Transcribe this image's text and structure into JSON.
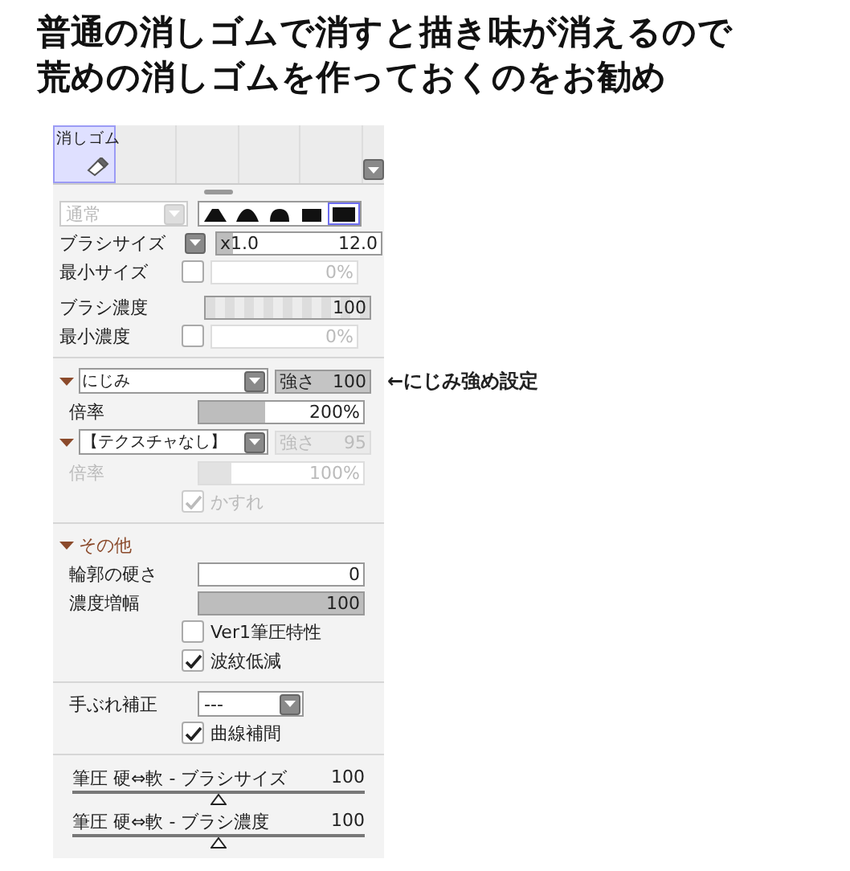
{
  "heading": [
    "普通の消しゴムで消すと描き味が消えるので",
    "荒めの消しゴムを作っておくのをお勧め"
  ],
  "tools": [
    {
      "label": "消しゴム",
      "selected": true
    },
    {
      "selected": false
    },
    {
      "selected": false
    },
    {
      "selected": false
    },
    {
      "selected": false
    }
  ],
  "blend_mode": {
    "value": "通常",
    "disabled": true
  },
  "brush_shapes": [
    {
      "selected": false
    },
    {
      "selected": false
    },
    {
      "selected": false
    },
    {
      "selected": false
    },
    {
      "selected": true
    }
  ],
  "brush_size": {
    "label": "ブラシサイズ",
    "multiplier": "x1.0",
    "value": "12.0",
    "level": 0.1
  },
  "min_size": {
    "label": "最小サイズ",
    "checked": false,
    "value": "0%",
    "disabled": true
  },
  "brush_density": {
    "label": "ブラシ濃度",
    "value": "100",
    "level": 1
  },
  "min_density": {
    "label": "最小濃度",
    "checked": false,
    "value": "0%",
    "disabled": true
  },
  "bleed": {
    "expanded": true,
    "value": "にじみ",
    "strength_label": "強さ",
    "strength": "100",
    "disabled": false,
    "rate_label": "倍率",
    "rate": "200%",
    "level": 0.4,
    "annotation": "←にじみ強め設定"
  },
  "texture": {
    "expanded": true,
    "value": "【テクスチャなし】",
    "strength_label": "強さ",
    "strength": "95",
    "disabled": true,
    "rate_label": "倍率",
    "rate": "100%",
    "level": 0.2,
    "option": {
      "label": "かすれ",
      "checked": true
    }
  },
  "other": {
    "label": "その他",
    "expanded": true,
    "fields": [
      {
        "label": "輪郭の硬さ",
        "value": "0"
      },
      {
        "label": "濃度増幅",
        "value": "100",
        "level": 1
      }
    ],
    "checks": [
      {
        "label": "Ver1筆圧特性",
        "checked": false
      },
      {
        "label": "波紋低減",
        "checked": true
      }
    ]
  },
  "stabilizer": {
    "label": "手ぶれ補正",
    "value": "---",
    "checks": [
      {
        "label": "曲線補間",
        "checked": true
      }
    ]
  },
  "pressure": [
    {
      "label": "筆圧 硬⇔軟 - ブラシサイズ",
      "value": "100",
      "level": 0.5
    },
    {
      "label": "筆圧 硬⇔軟 - ブラシ濃度",
      "value": "100",
      "level": 0.5
    }
  ]
}
